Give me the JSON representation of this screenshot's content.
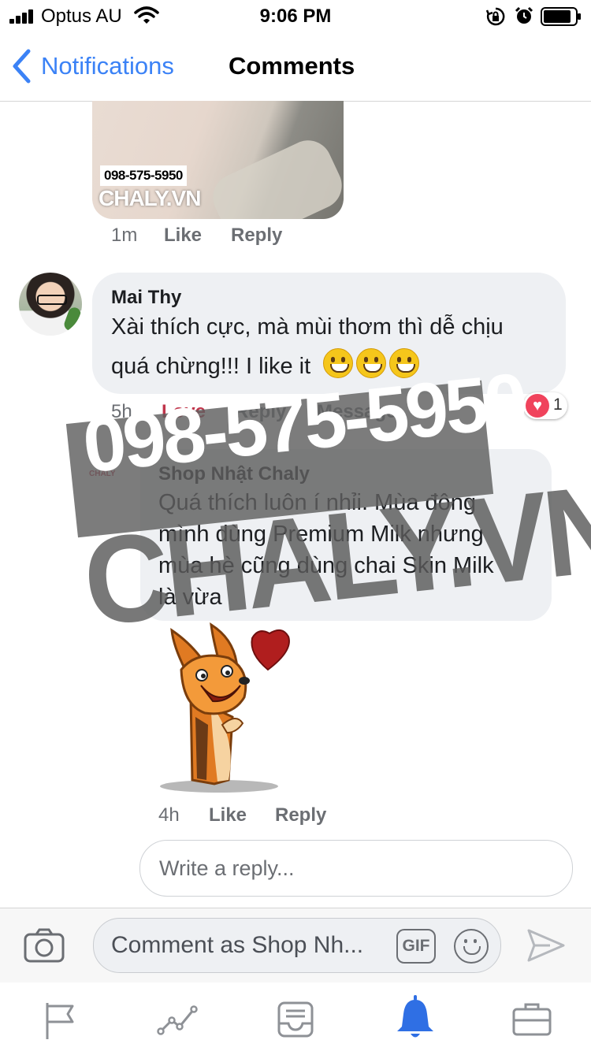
{
  "status_bar": {
    "carrier": "Optus AU",
    "time": "9:06 PM"
  },
  "nav": {
    "back_label": "Notifications",
    "title": "Comments"
  },
  "image_comment": {
    "watermark_phone": "098-575-5950",
    "watermark_site": "CHALY.VN",
    "time": "1m",
    "like_label": "Like",
    "reply_label": "Reply"
  },
  "comment": {
    "author": "Mai Thy",
    "text_line1": "Xài thích cực, mà mùi thơm thì dễ chịu",
    "text_line2": "quá chừng!!! I like it",
    "time": "5h",
    "love_label": "Love",
    "reply_label": "Reply",
    "message_label": "Message",
    "reaction_count": "1",
    "love_color": "#c0354b"
  },
  "reply": {
    "author": "Shop Nhật Chaly",
    "avatar_text": "CHALY",
    "lines": [
      "Quá thích luôn í nhỉi. Mùa đông",
      "mình dùng Premium Milk nhưng",
      "mùa hè cũng dùng chai Skin Milk",
      "là vừa"
    ],
    "time": "4h",
    "like_label": "Like",
    "reply_label": "Reply"
  },
  "reply_input": {
    "placeholder": "Write a reply..."
  },
  "composer": {
    "placeholder": "Comment as Shop Nh...",
    "gif_label": "GIF"
  },
  "overlay_watermark": {
    "phone": "098-575-5950",
    "site": "CHALY.VN"
  },
  "tabs": [
    {
      "icon": "flag-icon",
      "active": false
    },
    {
      "icon": "insights-icon",
      "active": false
    },
    {
      "icon": "inbox-icon",
      "active": false
    },
    {
      "icon": "bell-icon",
      "active": true
    },
    {
      "icon": "briefcase-icon",
      "active": false
    }
  ],
  "colors": {
    "accent": "#3b82f6",
    "active_tab": "#2f6fe4",
    "love": "#c0354b"
  }
}
